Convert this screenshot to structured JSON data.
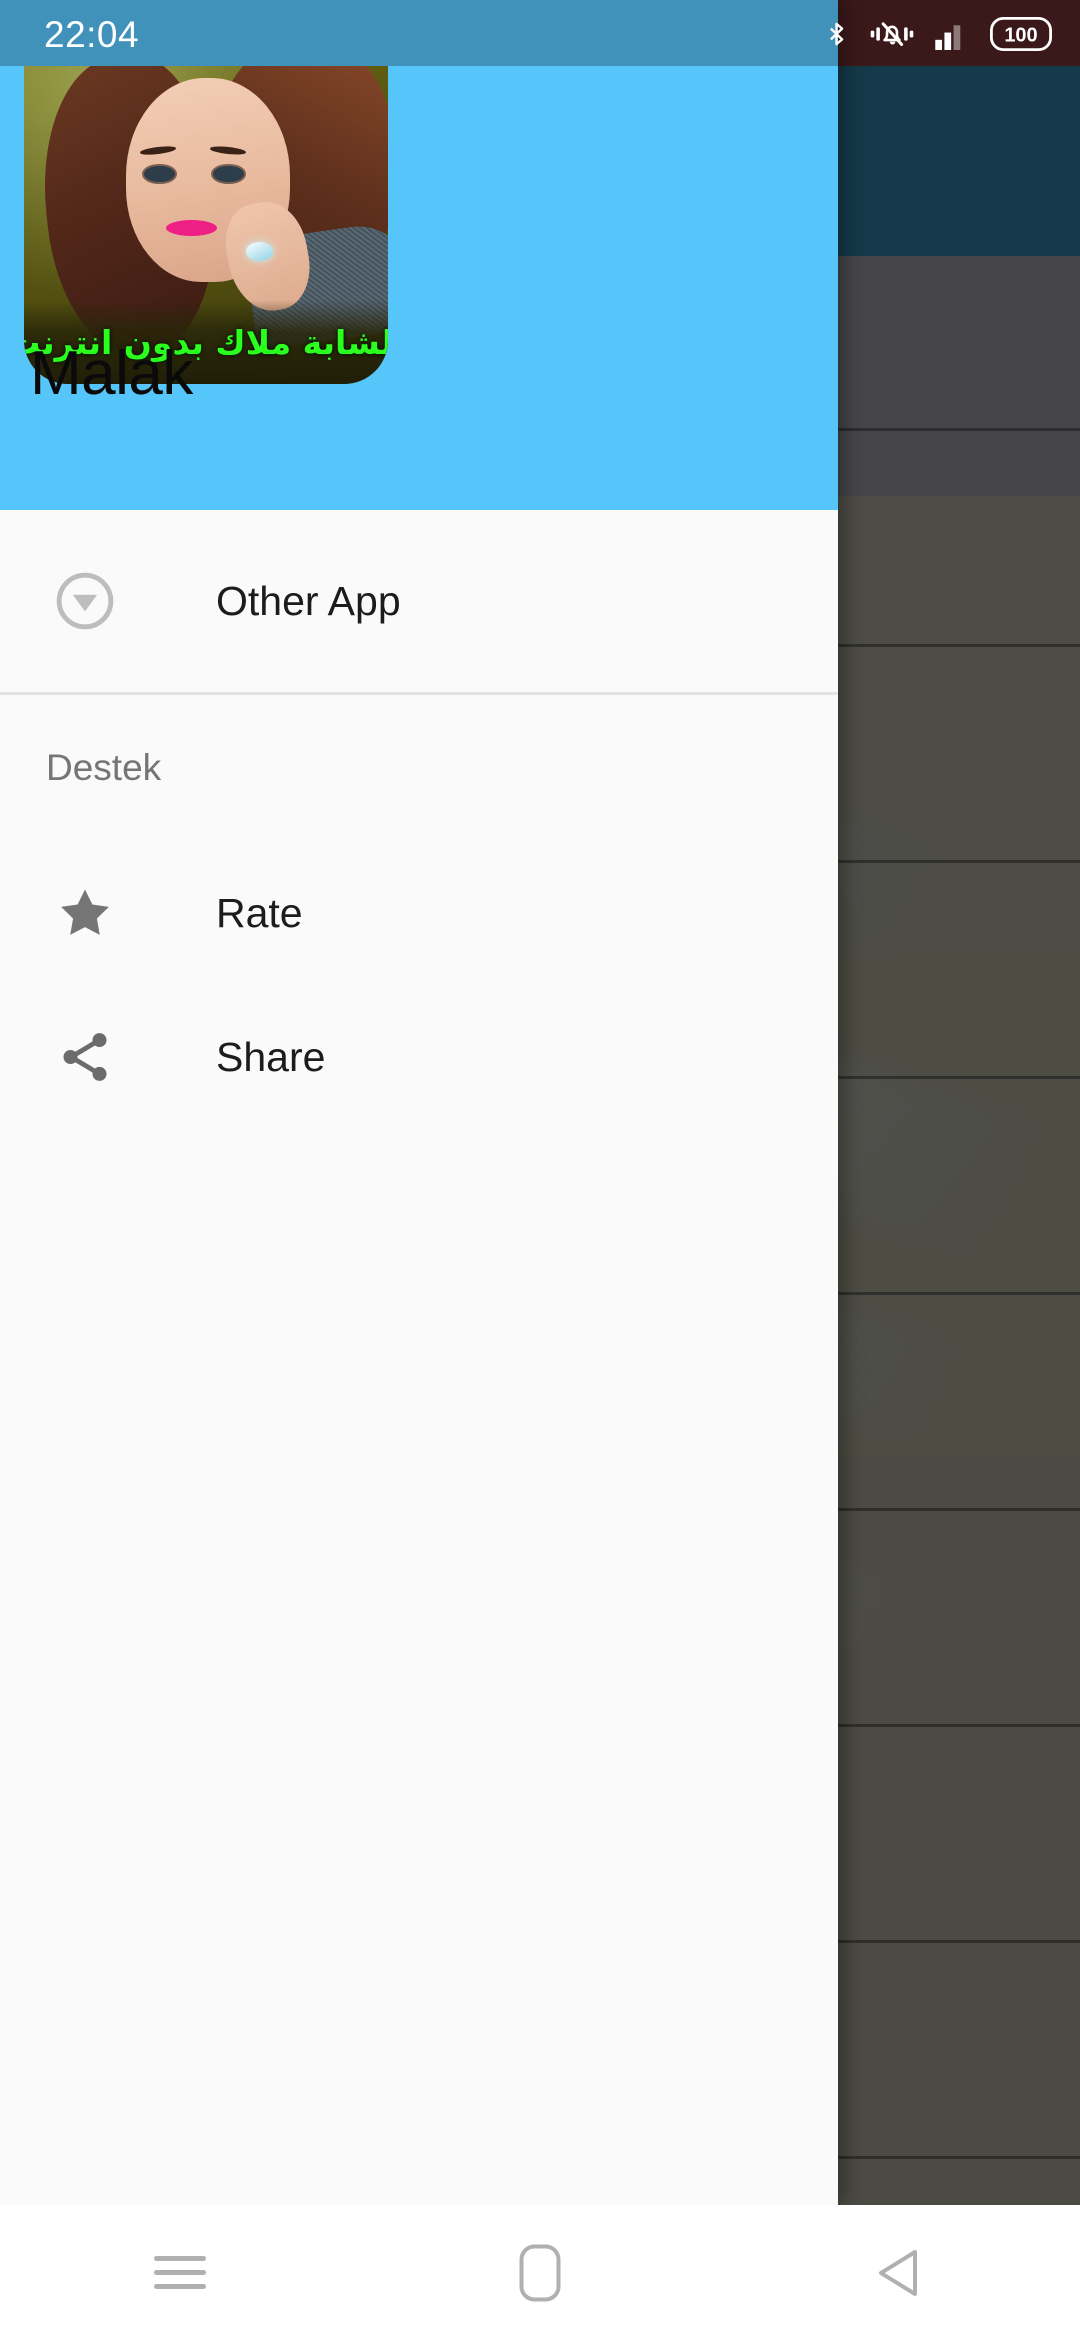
{
  "status_bar": {
    "time": "22:04",
    "icons": [
      {
        "name": "bluetooth-icon",
        "label": "Bluetooth"
      },
      {
        "name": "vibrate-off-icon",
        "label": "Silent / vibrate"
      },
      {
        "name": "signal-bars-icon",
        "label": "Mobile signal"
      },
      {
        "name": "battery-icon",
        "label": "Battery"
      }
    ],
    "battery_level": "100",
    "drawer_side_color": "#4092bb",
    "app_side_color": "#552526"
  },
  "drawer": {
    "header": {
      "title": "Malak",
      "background_color": "#55c5fa",
      "app_icon": {
        "name": "app-icon",
        "caption": "الشابة ملاك بدون انترنت",
        "caption_color": "#2bff1e"
      }
    },
    "items": [
      {
        "icon": "download-circle-icon",
        "label": "Other App"
      }
    ],
    "sections": [
      {
        "title": "Destek",
        "items": [
          {
            "icon": "star-icon",
            "label": "Rate"
          },
          {
            "icon": "share-icon",
            "label": "Share"
          }
        ]
      }
    ]
  },
  "background_app": {
    "app_bar_color": "#1d5369",
    "scrim_color": "rgba(0,0,0,0.30)"
  },
  "navigation_bar": {
    "buttons": [
      {
        "name": "recents-button",
        "icon": "menu-lines-icon"
      },
      {
        "name": "home-button",
        "icon": "home-square-icon"
      },
      {
        "name": "back-button",
        "icon": "back-triangle-icon"
      }
    ]
  }
}
